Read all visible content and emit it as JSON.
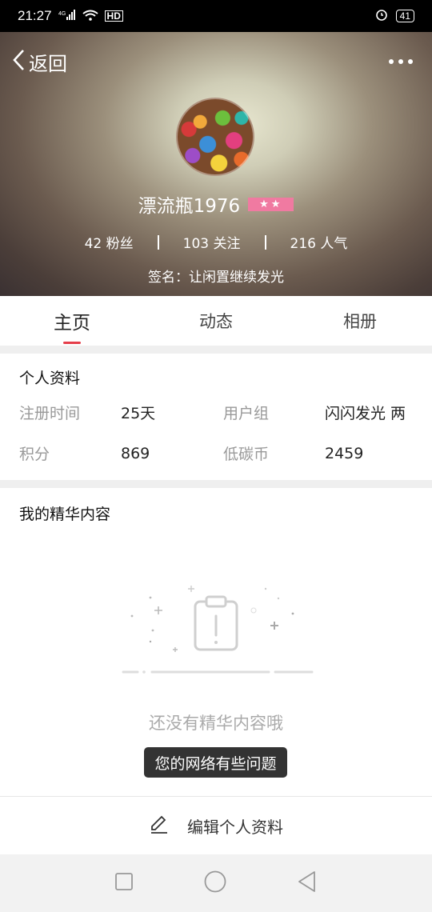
{
  "status_bar": {
    "time": "21:27",
    "network": "4G",
    "hd": "HD",
    "battery": "41"
  },
  "header": {
    "back_label": "返回",
    "more_icon": "more-dots-icon"
  },
  "profile": {
    "name": "漂流瓶1976",
    "level_stars": "★★",
    "stats": {
      "fans": "42 粉丝",
      "follow": "103 关注",
      "popularity": "216 人气"
    },
    "signature": "签名：让闲置继续发光"
  },
  "tabs": [
    {
      "label": "主页"
    },
    {
      "label": "动态"
    },
    {
      "label": "相册"
    }
  ],
  "personal_info": {
    "title": "个人资料",
    "rows": [
      {
        "label1": "注册时间",
        "value1": "25天",
        "label2": "用户组",
        "value2": "闪闪发光 两"
      },
      {
        "label1": "积分",
        "value1": "869",
        "label2": "低碳币",
        "value2": "2459"
      }
    ]
  },
  "featured": {
    "title": "我的精华内容",
    "empty_text": "还没有精华内容哦"
  },
  "toast": "您的网络有些问题",
  "edit_button": "编辑个人资料",
  "colors": {
    "accent": "#e53e4a",
    "badge": "#f07aa1"
  }
}
